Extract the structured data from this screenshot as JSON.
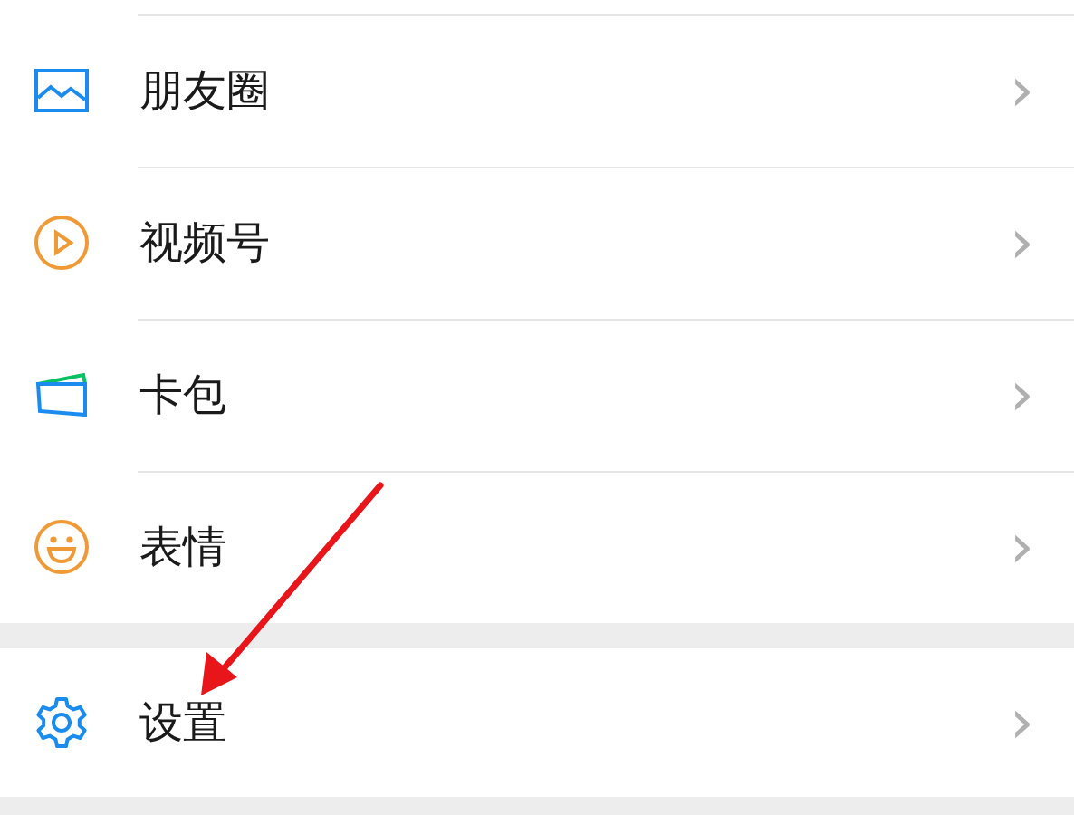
{
  "groups": [
    {
      "items": [
        {
          "kind": "moments",
          "label": "朋友圈",
          "chevron": "›"
        },
        {
          "kind": "channels",
          "label": "视频号",
          "chevron": "›"
        },
        {
          "kind": "cards",
          "label": "卡包",
          "chevron": "›"
        },
        {
          "kind": "stickers",
          "label": "表情",
          "chevron": "›"
        }
      ]
    },
    {
      "items": [
        {
          "kind": "settings",
          "label": "设置",
          "chevron": "›"
        }
      ]
    }
  ]
}
